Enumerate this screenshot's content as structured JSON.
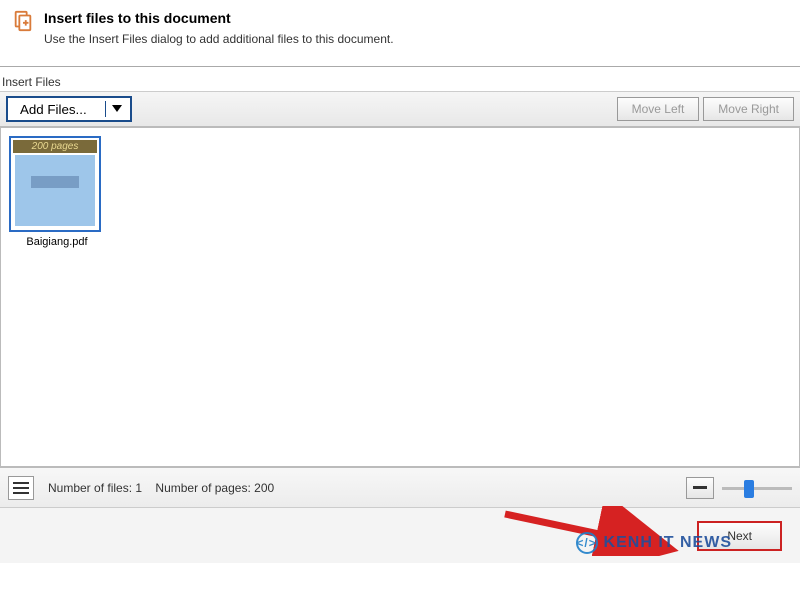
{
  "header": {
    "title": "Insert files to this document",
    "description": "Use the Insert Files dialog to add additional files to this document."
  },
  "panel": {
    "label": "Insert Files"
  },
  "toolbar": {
    "add_files": "Add Files...",
    "move_left": "Move Left",
    "move_right": "Move Right"
  },
  "files": [
    {
      "page_badge": "200 pages",
      "name": "Baigiang.pdf"
    }
  ],
  "status": {
    "files_label": "Number of files:",
    "files_count": "1",
    "pages_label": "Number of pages:",
    "pages_count": "200"
  },
  "footer": {
    "next": "Next"
  },
  "watermark": {
    "text": "KENH IT NEWS",
    "glyph": "</>"
  }
}
